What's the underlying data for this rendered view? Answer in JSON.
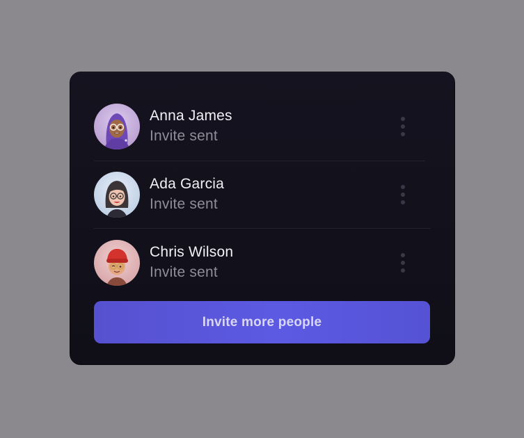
{
  "invites": [
    {
      "name": "Anna James",
      "status": "Invite sent",
      "avatar_icon": "memoji-hijab-glasses-avatar",
      "avatar_bg": "#c7b0dc"
    },
    {
      "name": "Ada Garcia",
      "status": "Invite sent",
      "avatar_icon": "memoji-glasses-avatar",
      "avatar_bg": "#cfdcec"
    },
    {
      "name": "Chris Wilson",
      "status": "Invite sent",
      "avatar_icon": "memoji-red-beanie-avatar",
      "avatar_bg": "#e2b6b8"
    }
  ],
  "more_icon": "kebab-vertical-icon",
  "invite_button_label": "Invite more people",
  "colors": {
    "backdrop": "#8b888e",
    "card": "#13121c",
    "accent": "#5c5ae3",
    "name_text": "#f1f0f6",
    "status_text": "#8f8d99"
  }
}
